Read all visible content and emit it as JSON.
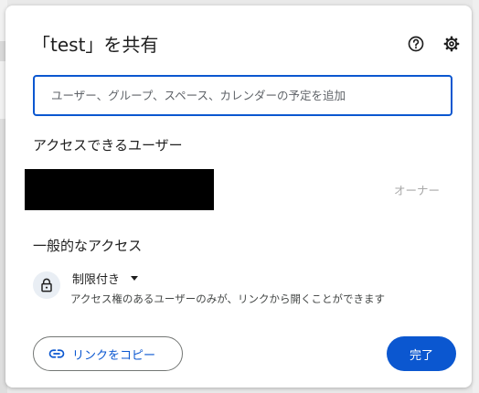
{
  "dialog": {
    "title": "「test」を共有",
    "help_icon": "help-circle-icon",
    "settings_icon": "gear-icon"
  },
  "search": {
    "placeholder": "ユーザー、グループ、スペース、カレンダーの予定を追加"
  },
  "people_section": {
    "title": "アクセスできるユーザー",
    "users": [
      {
        "name": "",
        "redacted": true,
        "role": "オーナー"
      }
    ]
  },
  "general_access": {
    "title": "一般的なアクセス",
    "icon": "lock-icon",
    "selected": "制限付き",
    "description": "アクセス権のあるユーザーのみが、リンクから開くことができます"
  },
  "footer": {
    "copy_link_label": "リンクをコピー",
    "copy_link_icon": "link-icon",
    "done_label": "完了"
  },
  "colors": {
    "accent": "#0b57d0",
    "text": "#1f1f1f",
    "muted": "#a8a8a8"
  }
}
